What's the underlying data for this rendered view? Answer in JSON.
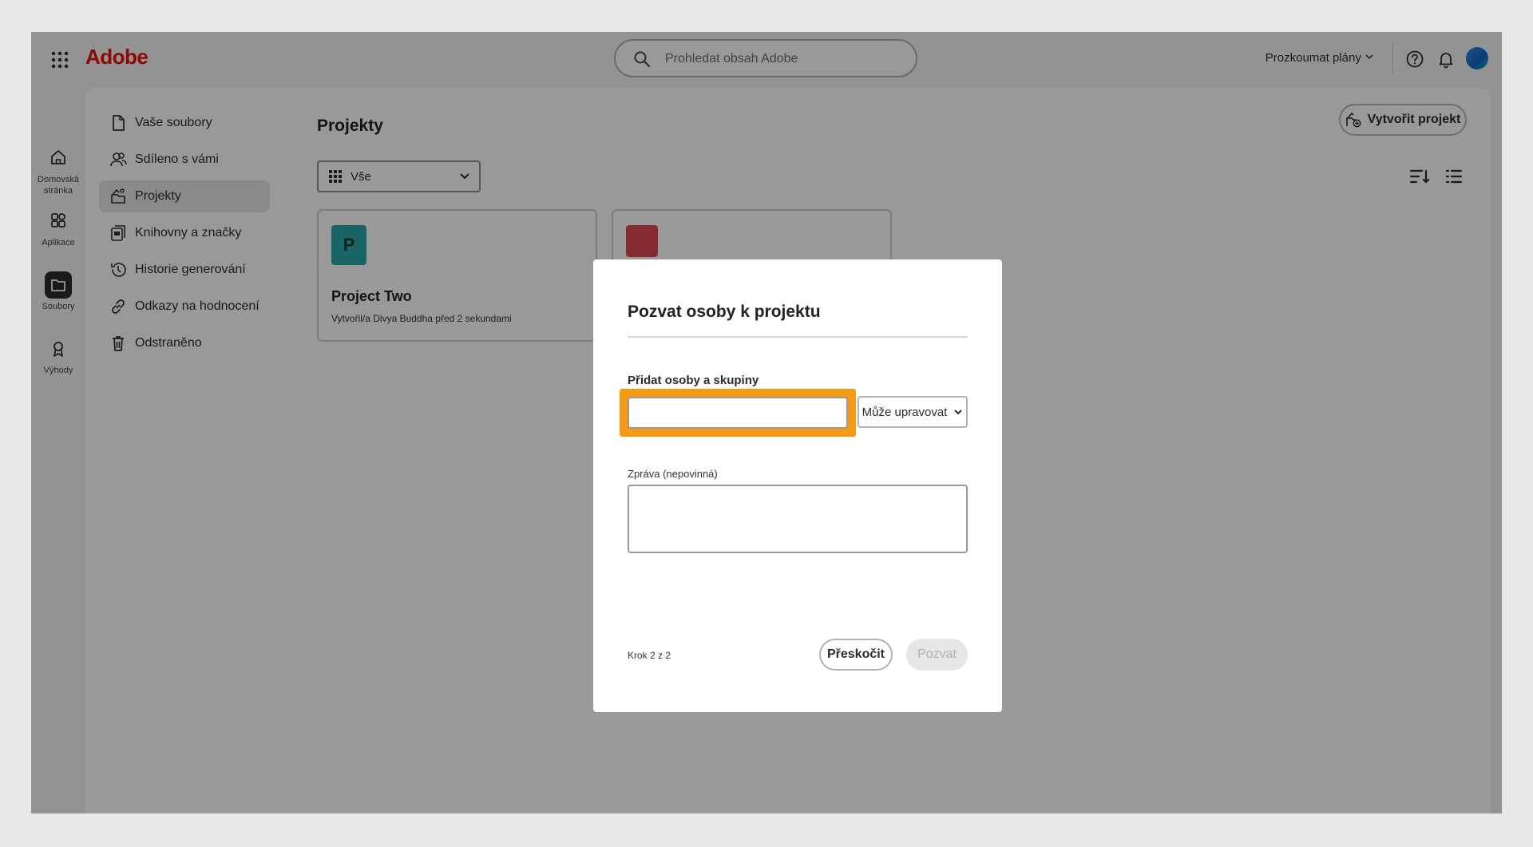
{
  "header": {
    "logo": "Adobe",
    "search_placeholder": "Prohledat obsah Adobe",
    "plans_label": "Prozkoumat plány"
  },
  "rail": {
    "items": [
      {
        "label": "Domovská stránka",
        "icon": "home-icon"
      },
      {
        "label": "Aplikace",
        "icon": "apps-icon"
      },
      {
        "label": "Soubory",
        "icon": "folder-icon",
        "active": true
      },
      {
        "label": "Výhody",
        "icon": "award-icon"
      }
    ]
  },
  "sidebar": {
    "items": [
      {
        "label": "Vaše soubory",
        "icon": "file-icon"
      },
      {
        "label": "Sdíleno s vámi",
        "icon": "shared-users-icon"
      },
      {
        "label": "Projekty",
        "icon": "projects-icon",
        "active": true
      },
      {
        "label": "Knihovny a značky",
        "icon": "library-icon"
      },
      {
        "label": "Historie generování",
        "icon": "history-icon"
      },
      {
        "label": "Odkazy na hodnocení",
        "icon": "link-icon"
      },
      {
        "label": "Odstraněno",
        "icon": "trash-icon"
      }
    ]
  },
  "main": {
    "title": "Projekty",
    "filter_label": "Vše",
    "create_button": "Vytvořit projekt",
    "cards": [
      {
        "badge": "P",
        "title": "Project Two",
        "subtitle": "Vytvořil/a Divya Buddha před 2 sekundami"
      }
    ]
  },
  "dialog": {
    "title": "Pozvat osoby k projektu",
    "add_label": "Přidat osoby a skupiny",
    "add_value": "",
    "permission": "Může upravovat",
    "message_label": "Zpráva (nepovinná)",
    "message_value": "",
    "step": "Krok 2 z 2",
    "skip_button": "Přeskočit",
    "invite_button": "Pozvat"
  },
  "colors": {
    "brand": "#eb1000",
    "highlight": "#f59a13",
    "badge": "#2aa7a7"
  }
}
